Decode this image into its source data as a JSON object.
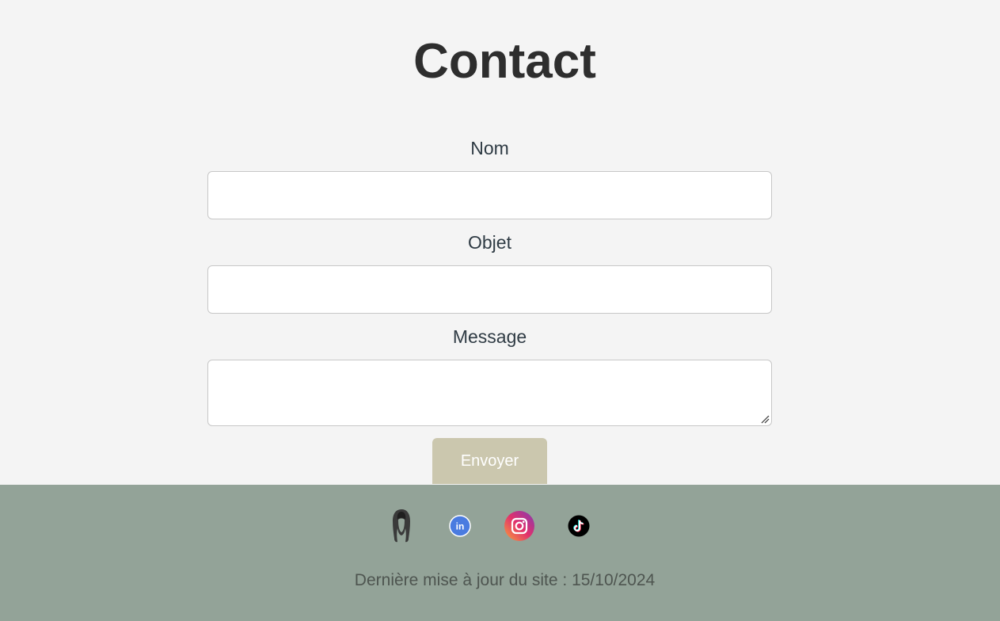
{
  "page": {
    "title": "Contact"
  },
  "form": {
    "name_label": "Nom",
    "name_value": "",
    "subject_label": "Objet",
    "subject_value": "",
    "message_label": "Message",
    "message_value": "",
    "submit_label": "Envoyer"
  },
  "footer": {
    "social_icons": [
      "profile-silhouette-icon",
      "linkedin-icon",
      "instagram-icon",
      "tiktok-icon"
    ],
    "last_update_text": "Dernière mise à jour du site : 15/10/2024"
  },
  "colors": {
    "background": "#f4f4f4",
    "title": "#2e2e2e",
    "button": "#cbc7ae",
    "footer": "#93a398",
    "linkedin": "#4a7be0",
    "instagram_gradient": [
      "#f9a23a",
      "#e1306c",
      "#833ab4"
    ],
    "tiktok": "#000000"
  }
}
